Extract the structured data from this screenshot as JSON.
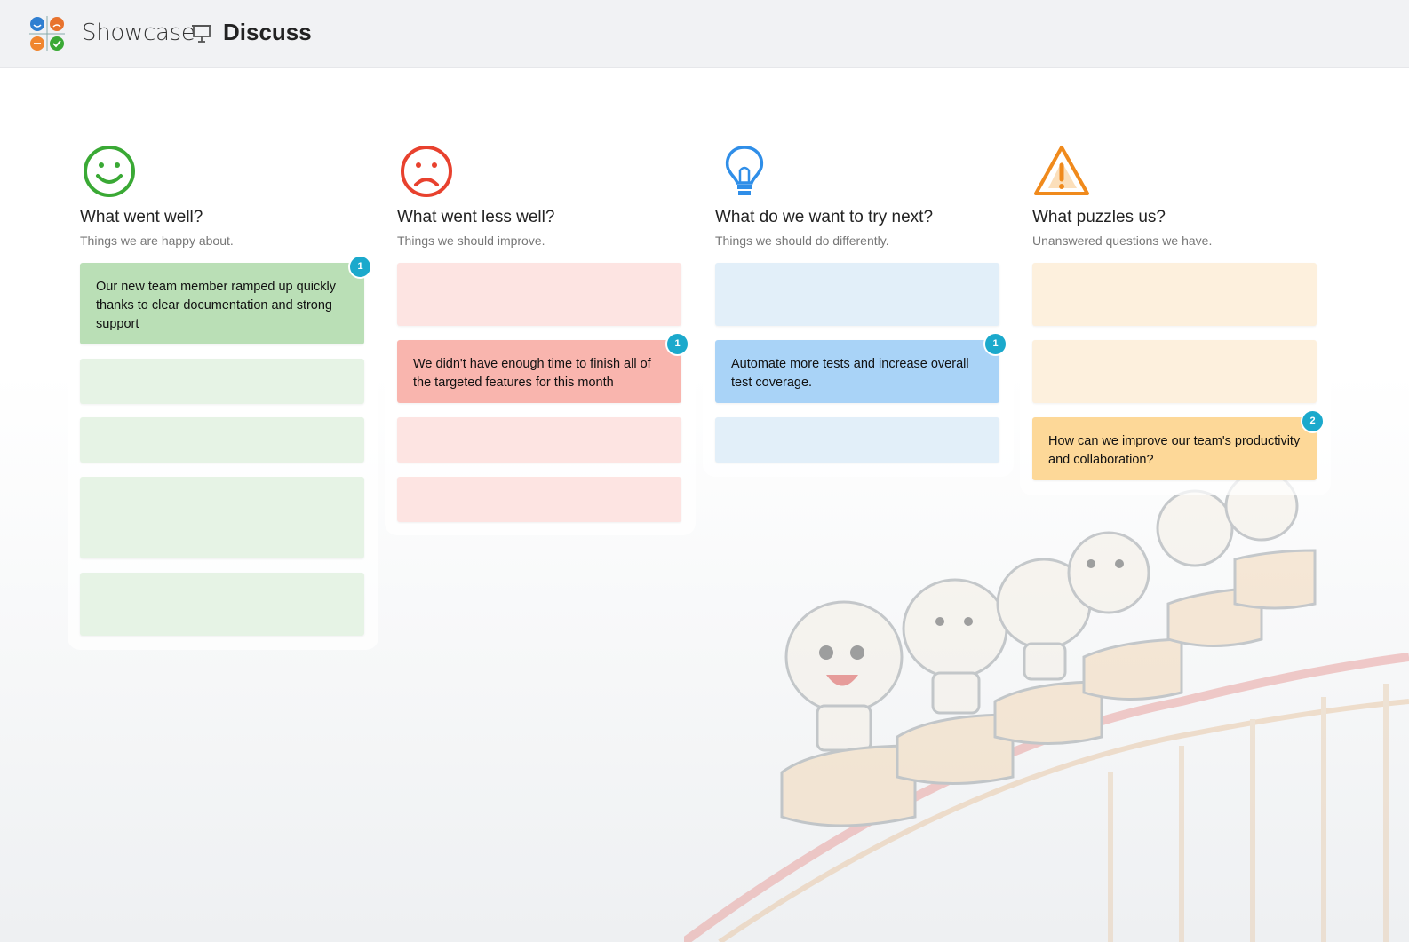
{
  "header": {
    "app_title": "Showcase",
    "board_title": "Discuss"
  },
  "columns": [
    {
      "title": "What went well?",
      "subtitle": "Things we are happy about.",
      "icon": "smiley-face-icon",
      "color": "#3aa935",
      "cards": [
        {
          "text": "Our new team member ramped up quickly thanks to clear documentation and strong support",
          "votes": "1"
        }
      ]
    },
    {
      "title": "What went less well?",
      "subtitle": "Things we should improve.",
      "icon": "sad-face-icon",
      "color": "#e8412e",
      "cards": [
        {
          "text": "We didn't have enough time to finish all of the targeted features for this month",
          "votes": "1"
        }
      ]
    },
    {
      "title": "What do we want to try next?",
      "subtitle": "Things we should do differently.",
      "icon": "lightbulb-icon",
      "color": "#2f8ee8",
      "cards": [
        {
          "text": "Automate more tests and increase overall test coverage.",
          "votes": "1"
        }
      ]
    },
    {
      "title": "What puzzles us?",
      "subtitle": "Unanswered questions we have.",
      "icon": "warning-icon",
      "color": "#f08a1c",
      "cards": [
        {
          "text": "How can we improve our team's productivity and collaboration?",
          "votes": "2"
        }
      ]
    }
  ],
  "colors": {
    "green_card": "#badfb6",
    "green_empty": "#e6f3e5",
    "red_card": "#f9b5ae",
    "red_empty": "#fde4e2",
    "blue_card": "#a9d3f7",
    "blue_empty": "#e2eff9",
    "orange_card": "#fdd898",
    "orange_empty": "#fdf0dd",
    "badge": "#1ba9cc"
  },
  "background_art": "lightbulbs-rollercoaster-illustration"
}
